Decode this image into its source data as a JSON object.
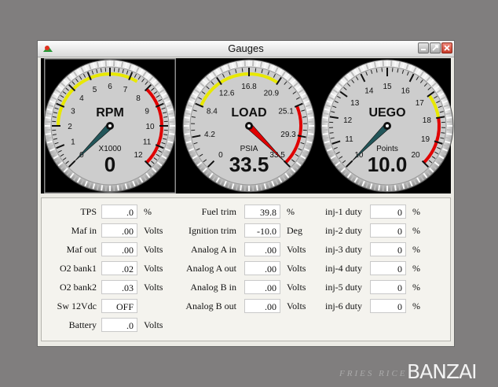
{
  "window": {
    "title": "Gauges"
  },
  "colors": {
    "needle": "#22565a",
    "accent_red": "#e00000",
    "accent_yellow": "#e8e800",
    "face": "#c9c9c9"
  },
  "gauges": [
    {
      "id": "rpm",
      "label": "RPM",
      "sublabel": "X1000",
      "readout": "0",
      "value": 0,
      "min": 0,
      "max": 12,
      "ticks": [
        "0",
        "1",
        "2",
        "3",
        "4",
        "5",
        "6",
        "7",
        "8",
        "9",
        "10",
        "11",
        "12"
      ],
      "yellow": [
        2,
        7.4
      ],
      "red": [
        8,
        12
      ]
    },
    {
      "id": "load",
      "label": "LOAD",
      "sublabel": "PSIA",
      "readout": "33.5",
      "value": 33.5,
      "min": 0,
      "max": 33.5,
      "ticks": [
        "0",
        "4.2",
        "8.4",
        "12.6",
        "16.8",
        "20.9",
        "25.1",
        "29.3",
        "33.5"
      ],
      "yellow": [
        8.4,
        20.9
      ],
      "red": [
        25.1,
        33.5
      ]
    },
    {
      "id": "uego",
      "label": "UEGO",
      "sublabel": "Points",
      "readout": "10.0",
      "value": 10,
      "min": 10,
      "max": 20,
      "ticks": [
        "10",
        "11",
        "12",
        "13",
        "14",
        "15",
        "16",
        "17",
        "18",
        "19",
        "20"
      ],
      "yellow": [
        17,
        18
      ],
      "red": [
        18,
        20
      ]
    }
  ],
  "fields": {
    "col1": [
      {
        "label": "TPS",
        "value": ".0",
        "unit": "%"
      },
      {
        "label": "Maf in",
        "value": ".00",
        "unit": "Volts"
      },
      {
        "label": "Maf out",
        "value": ".00",
        "unit": "Volts"
      },
      {
        "label": "O2 bank1",
        "value": ".02",
        "unit": "Volts"
      },
      {
        "label": "O2 bank2",
        "value": ".03",
        "unit": "Volts"
      },
      {
        "label": "Sw 12Vdc",
        "value": "OFF",
        "unit": ""
      },
      {
        "label": "Battery",
        "value": ".0",
        "unit": "Volts"
      }
    ],
    "col2": [
      {
        "label": "Fuel trim",
        "value": "39.8",
        "unit": "%"
      },
      {
        "label": "Ignition trim",
        "value": "-10.0",
        "unit": "Deg"
      },
      {
        "label": "Analog A in",
        "value": ".00",
        "unit": "Volts"
      },
      {
        "label": "Analog A out",
        "value": ".00",
        "unit": "Volts"
      },
      {
        "label": "Analog B in",
        "value": ".00",
        "unit": "Volts"
      },
      {
        "label": "Analog B out",
        "value": ".00",
        "unit": "Volts"
      }
    ],
    "col3": [
      {
        "label": "inj-1 duty",
        "value": "0",
        "unit": "%"
      },
      {
        "label": "inj-2 duty",
        "value": "0",
        "unit": "%"
      },
      {
        "label": "inj-3 duty",
        "value": "0",
        "unit": "%"
      },
      {
        "label": "inj-4 duty",
        "value": "0",
        "unit": "%"
      },
      {
        "label": "inj-5 duty",
        "value": "0",
        "unit": "%"
      },
      {
        "label": "inj-6 duty",
        "value": "0",
        "unit": "%"
      }
    ]
  },
  "branding": {
    "small_text": "FRIES RICE",
    "big_text": "BANZAI"
  }
}
